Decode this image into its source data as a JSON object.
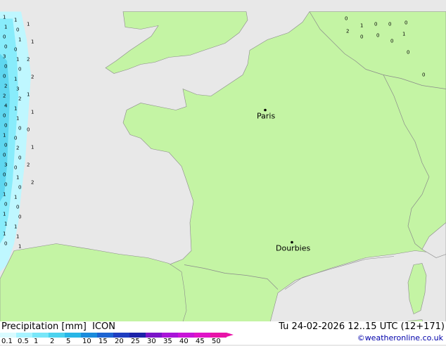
{
  "map": {
    "colors": {
      "land": "#c4f4a4",
      "sea": "#e8e8e8",
      "border": "#8a8a8a",
      "coast": "#8a8a8a"
    },
    "cities": [
      {
        "name": "Paris"
      },
      {
        "name": "Dourbies"
      }
    ],
    "precip_labels": [
      "1",
      "1",
      "1",
      "0",
      "0",
      "1",
      "0",
      "0",
      "3",
      "1",
      "0",
      "0",
      "0",
      "1",
      "2",
      "3",
      "2",
      "2",
      "4",
      "1",
      "0",
      "1",
      "0",
      "0",
      "1",
      "0",
      "0",
      "2",
      "0",
      "0",
      "3",
      "0",
      "0",
      "1",
      "0",
      "0",
      "1",
      "1",
      "0",
      "0",
      "1",
      "0",
      "1",
      "1",
      "1",
      "1",
      "0",
      "1",
      "1",
      "1",
      "2",
      "2",
      "1",
      "1",
      "0",
      "1",
      "2",
      "2",
      "0",
      "1",
      "0",
      "0",
      "0",
      "2",
      "0",
      "0",
      "0",
      "1",
      "0",
      "0"
    ]
  },
  "footer": {
    "title": "Precipitation [mm]  ICON",
    "datetime": "Tu 24-02-2026 12..15 UTC (12+171)",
    "credit": "©weatheronline.co.uk",
    "legend_labels": [
      "0.1",
      "0.5",
      "1",
      "2",
      "5",
      "10",
      "15",
      "20",
      "25",
      "30",
      "35",
      "40",
      "45",
      "50"
    ],
    "legend_colors": [
      "#d9fbff",
      "#a6f3ff",
      "#78e6f8",
      "#4bd2ee",
      "#28b6e6",
      "#1a8cdc",
      "#1c64d2",
      "#1e3ec0",
      "#1c22a8",
      "#7a14c8",
      "#a814d8",
      "#c814d8",
      "#e014c8",
      "#e814a8"
    ]
  }
}
